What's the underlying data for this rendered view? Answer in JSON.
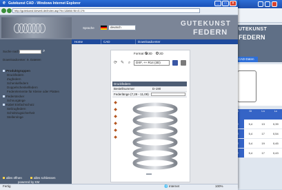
{
  "window": {
    "title": "Gutekunst CAD - Windows Internet Explorer"
  },
  "address": {
    "url": "http://gutekunst.kiewek.de/index.asp?ln=1&bild=Nr=0-1% "
  },
  "header": {
    "lang_label": "Sprache",
    "lang_value": "deutsch",
    "logo_line1": "GUTEKUNST",
    "logo_line2": "FEDERN"
  },
  "nav": {
    "items": [
      "Home",
      "CAD",
      "Downloadcenter"
    ]
  },
  "sidebar": {
    "search_label": "Suche nach",
    "download_text": "Downloadcenter: 9. Dateien",
    "group_title": "Produktgruppen",
    "items": [
      "Druckfedern",
      "Zugfedern",
      "Schenkelfedern",
      "Doppelschenkelfedern",
      "Federelemente für Kleine oder Platten",
      "Federstecker",
      "Schnurgänge",
      "Kabel Einfachschutz",
      "Seilzugfedern",
      "Schnittzugsicherheit",
      "Stellenringe"
    ],
    "footer1": "alles öffnen",
    "footer2": "alles schliessen",
    "footer3": "powered by KM"
  },
  "content": {
    "format_label": "Format",
    "format_options": [
      "3D",
      "2D"
    ],
    "format_select": "DXF, ++ R14 (3D)",
    "table_title": "Druckfedern",
    "row1_label": "Bestellnummer",
    "row1_value": "D-190",
    "row2_label": "Federlänge (7,29 - 11,09)"
  },
  "status": {
    "left": "Fertig",
    "zone": "Internet",
    "zoom": "100%"
  },
  "bgwin": {
    "toolbar_text": "Extras",
    "brand1": "GUTEKUNST",
    "brand2": "FEDERN",
    "cad_label": "CAD-Daten",
    "table_headers": [
      "d",
      "Di",
      "Ln",
      "Lc"
    ],
    "table_rows": [
      [
        "2",
        "5,4",
        "13",
        "0,39"
      ],
      [
        "2",
        "5,4",
        "17",
        "0,54"
      ],
      [
        "2",
        "5,4",
        "19",
        "0,45"
      ],
      [
        "2",
        "5,4",
        "17",
        "0,43"
      ]
    ]
  },
  "colors": {
    "titlebar": "#1e5ac6",
    "sidebar": "#4f5f76",
    "nav": "#1e4a9c",
    "logo_bg": "#7b8597"
  }
}
